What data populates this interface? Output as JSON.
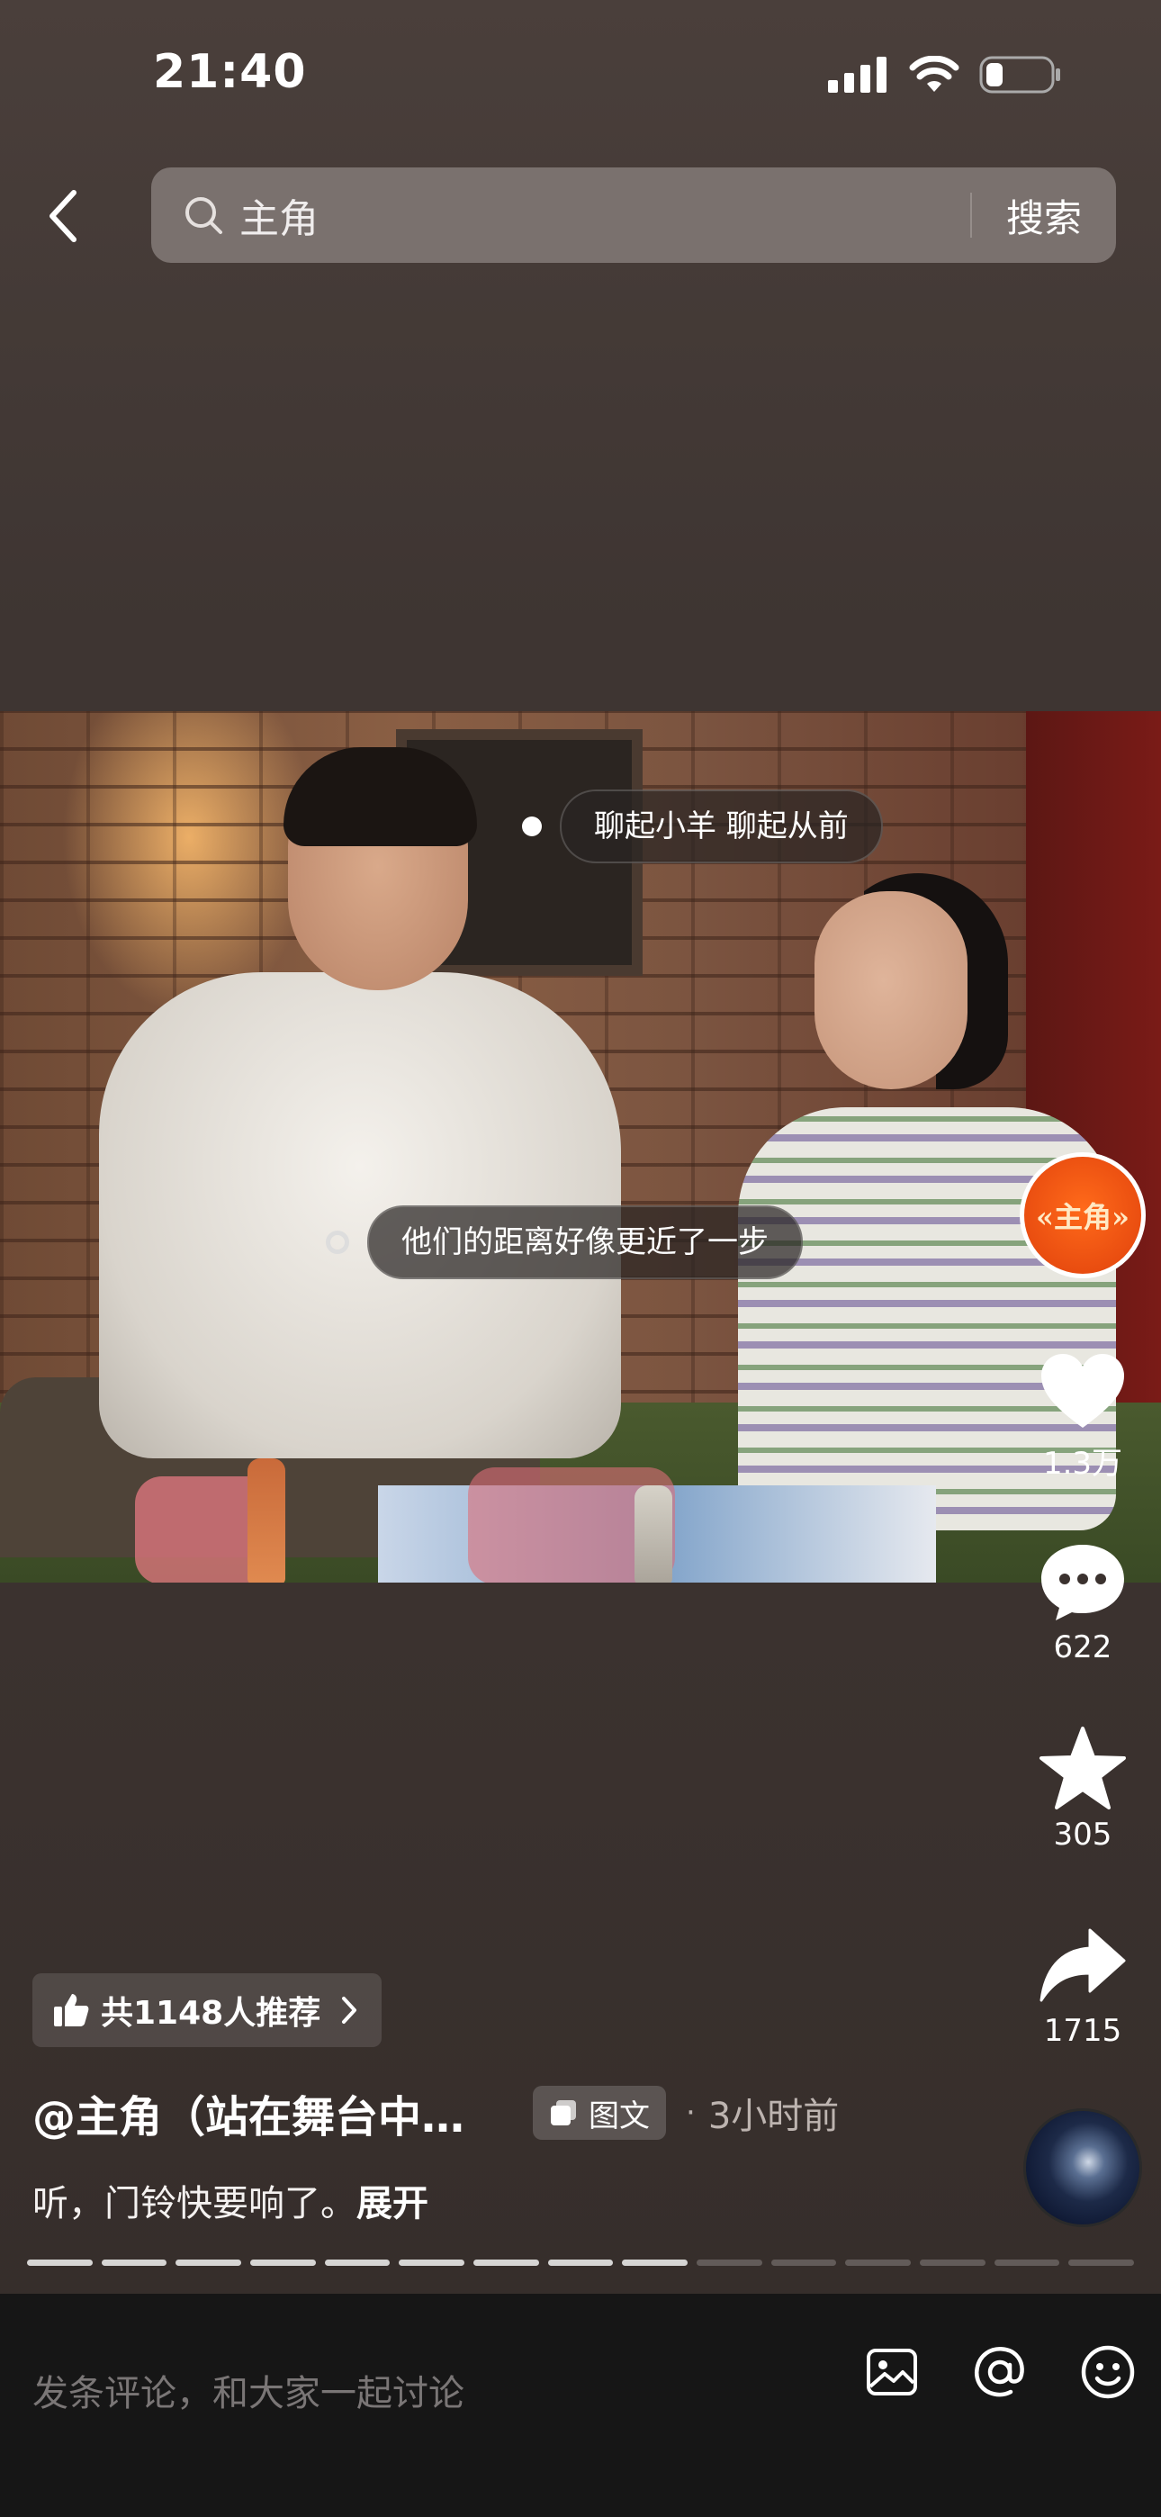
{
  "status_bar": {
    "time": "21:40"
  },
  "search": {
    "query": "主角",
    "button_label": "搜索"
  },
  "photo_tags": [
    {
      "label": "聊起小羊 聊起从前"
    },
    {
      "label": "他们的距离好像更近了一步"
    }
  ],
  "account_avatar": {
    "text": "«主角»"
  },
  "actions": {
    "like_count": "1.3万",
    "comment_count": "622",
    "favorite_count": "305",
    "share_count": "1715"
  },
  "recommend": {
    "label": "共1148人推荐"
  },
  "post": {
    "author": "@主角（站在舞台中…",
    "type_label": "图文",
    "separator": "·",
    "time": "3小时前",
    "caption": "听，门铃快要响了。",
    "expand_label": "展开"
  },
  "gallery": {
    "total_images": 15,
    "current_index": 9
  },
  "comment_bar": {
    "placeholder": "发条评论，和大家一起讨论"
  }
}
